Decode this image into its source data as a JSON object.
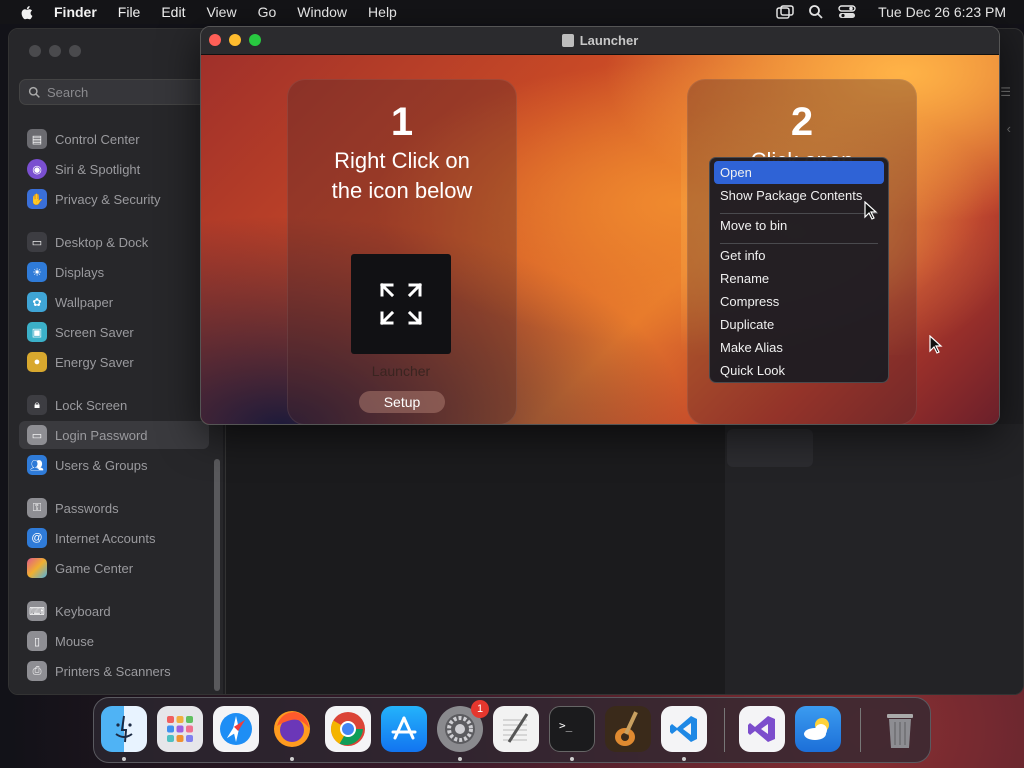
{
  "menubar": {
    "app_name": "Finder",
    "menus": [
      "File",
      "Edit",
      "View",
      "Go",
      "Window",
      "Help"
    ],
    "clock": "Tue Dec 26  6:23 PM",
    "status_icons": [
      "screen-mirroring-icon",
      "search-icon",
      "control-center-icon"
    ]
  },
  "settings": {
    "search_placeholder": "Search",
    "sidebar": [
      {
        "label": "Control Center",
        "icon": "control-center-icon",
        "color": "#6b6b70"
      },
      {
        "label": "Siri & Spotlight",
        "icon": "siri-icon",
        "color": "#7a4fd0"
      },
      {
        "label": "Privacy & Security",
        "icon": "hand-icon",
        "color": "#3a6fd8"
      },
      {
        "label": "Desktop & Dock",
        "icon": "desktop-icon",
        "color": "#3d3d42"
      },
      {
        "label": "Displays",
        "icon": "displays-icon",
        "color": "#2f7bd8"
      },
      {
        "label": "Wallpaper",
        "icon": "wallpaper-icon",
        "color": "#3fa5d6"
      },
      {
        "label": "Screen Saver",
        "icon": "screen-saver-icon",
        "color": "#3bb0c8"
      },
      {
        "label": "Energy Saver",
        "icon": "energy-icon",
        "color": "#d8a82e"
      },
      {
        "label": "Lock Screen",
        "icon": "lock-icon",
        "color": "#3d3d42"
      },
      {
        "label": "Login Password",
        "icon": "login-password-icon",
        "color": "#8e8e93"
      },
      {
        "label": "Users & Groups",
        "icon": "users-icon",
        "color": "#2f7bd8"
      },
      {
        "label": "Passwords",
        "icon": "key-icon",
        "color": "#8e8e93"
      },
      {
        "label": "Internet Accounts",
        "icon": "at-icon",
        "color": "#2f7bd8"
      },
      {
        "label": "Game Center",
        "icon": "game-center-icon",
        "color": "#e05a8a"
      },
      {
        "label": "Keyboard",
        "icon": "keyboard-icon",
        "color": "#8e8e93"
      },
      {
        "label": "Mouse",
        "icon": "mouse-icon",
        "color": "#8e8e93"
      },
      {
        "label": "Printers & Scanners",
        "icon": "printer-icon",
        "color": "#8e8e93"
      }
    ],
    "selected_index": 9
  },
  "launcher": {
    "title": "Launcher",
    "step1": {
      "number": "1",
      "line1": "Right Click on",
      "line2": "the icon below"
    },
    "step2": {
      "number": "2",
      "line1": "Click open"
    },
    "app_label": "Launcher",
    "setup_button": "Setup",
    "context_menu": {
      "groups": [
        [
          "Open",
          "Show Package Contents"
        ],
        [
          "Move to bin"
        ],
        [
          "Get info",
          "Rename",
          "Compress",
          "Duplicate",
          "Make Alias",
          "Quick Look"
        ]
      ],
      "highlighted": "Open"
    }
  },
  "dock": {
    "apps": [
      {
        "name": "finder-icon",
        "running": true
      },
      {
        "name": "launchpad-icon",
        "running": false
      },
      {
        "name": "safari-icon",
        "running": false
      },
      {
        "name": "firefox-icon",
        "running": true
      },
      {
        "name": "chrome-icon",
        "running": false
      },
      {
        "name": "app-store-icon",
        "running": false
      },
      {
        "name": "system-settings-icon",
        "running": true,
        "badge": "1"
      },
      {
        "name": "textedit-icon",
        "running": false
      },
      {
        "name": "terminal-icon",
        "running": true
      },
      {
        "name": "garageband-icon",
        "running": false
      },
      {
        "name": "vscode-icon",
        "running": true
      },
      {
        "name": "visual-studio-icon",
        "running": false
      },
      {
        "name": "weather-icon",
        "running": false
      },
      {
        "name": "trash-icon",
        "running": false
      }
    ],
    "colors": {
      "accent": "#2f63d6",
      "badge": "#e5372e"
    }
  }
}
